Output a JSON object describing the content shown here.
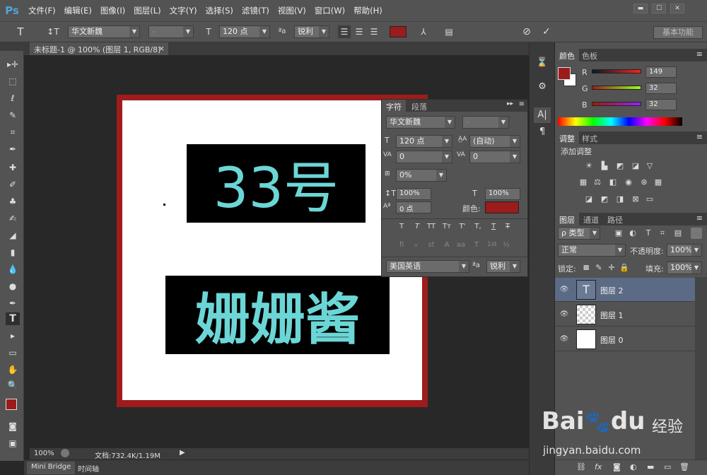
{
  "app": {
    "logo": "Ps"
  },
  "menu": [
    "文件(F)",
    "编辑(E)",
    "图像(I)",
    "图层(L)",
    "文字(Y)",
    "选择(S)",
    "滤镜(T)",
    "视图(V)",
    "窗口(W)",
    "帮助(H)"
  ],
  "window_buttons": {
    "min": "▬",
    "max": "☐",
    "close": "✕"
  },
  "options": {
    "font_family": "华文新魏",
    "font_style": "-",
    "font_size": "120 点",
    "aa_label": "ªa",
    "aa_mode": "锐利",
    "color": "#9b1c1c",
    "workspace": "基本功能"
  },
  "document": {
    "tab_title": "未标题-1 @ 100% (图层 1, RGB/8) *",
    "text_top": "33号",
    "text_bottom": "姗姗酱",
    "frame_color": "#9e1c1c",
    "text_color": "#6cd6d6"
  },
  "status": {
    "zoom": "100%",
    "doc_info": "文档:732.4K/1.19M"
  },
  "bottom_tabs": [
    "Mini Bridge",
    "时间轴"
  ],
  "char_panel": {
    "tabs": [
      "字符",
      "段落"
    ],
    "font_family": "华文新魏",
    "font_style": "-",
    "size": "120 点",
    "leading": "(自动)",
    "kerning": "0",
    "tracking": "0",
    "scale_tsume": "0%",
    "vscale": "100%",
    "hscale": "100%",
    "baseline": "0 点",
    "color_label": "颜色:",
    "color": "#9b1c1c",
    "style_buttons": [
      "T",
      "T",
      "TT",
      "Tт",
      "T'",
      "T,",
      "T",
      "T"
    ],
    "ot_buttons": [
      "fi",
      "ℴ",
      "st",
      "A",
      "aa",
      "T",
      "1st",
      "½"
    ],
    "language": "美国英语",
    "aa_label": "ªa",
    "aa_mode": "锐利"
  },
  "color_panel": {
    "tabs": [
      "颜色",
      "色板"
    ],
    "fg": "#9b1c1c",
    "r_label": "R",
    "r": "149",
    "g_label": "G",
    "g": "32",
    "b_label": "B",
    "b": "32"
  },
  "adjust_panel": {
    "tabs": [
      "调整",
      "样式"
    ],
    "title": "添加调整"
  },
  "layers_panel": {
    "tabs": [
      "图层",
      "通道",
      "路径"
    ],
    "filter": "ρ 类型",
    "blend": "正常",
    "opacity_label": "不透明度:",
    "opacity": "100%",
    "lock_label": "锁定:",
    "fill_label": "填充:",
    "fill": "100%",
    "layers": [
      {
        "name": "图层 2",
        "type": "text",
        "selected": true
      },
      {
        "name": "图层 1",
        "type": "transparent",
        "selected": false
      },
      {
        "name": "图层 0",
        "type": "white",
        "selected": false
      }
    ],
    "footer_icons": [
      "⛓",
      "fx",
      "◙",
      "◐",
      "▬",
      "▭",
      "🗑"
    ]
  },
  "watermark": {
    "brand": "Bai",
    "brand2": "du",
    "suffix": "经验",
    "url": "jingyan.baidu.com"
  }
}
